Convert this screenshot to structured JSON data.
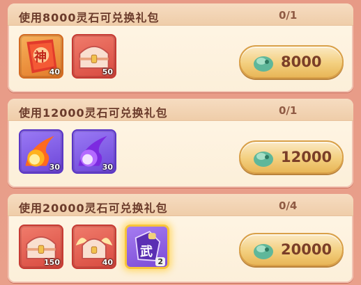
{
  "packs": [
    {
      "title": "使用8000灵石可兑换礼包",
      "count": "0/1",
      "price": "8000",
      "items": [
        {
          "icon": "scroll-icon",
          "qty": "40",
          "color": "orange"
        },
        {
          "icon": "treasure-chest-icon",
          "qty": "50",
          "color": "red"
        }
      ]
    },
    {
      "title": "使用12000灵石可兑换礼包",
      "count": "0/1",
      "price": "12000",
      "items": [
        {
          "icon": "orange-fireball-icon",
          "qty": "30",
          "color": "purple"
        },
        {
          "icon": "purple-fireball-icon",
          "qty": "30",
          "color": "purple"
        }
      ]
    },
    {
      "title": "使用20000灵石可兑换礼包",
      "count": "0/4",
      "price": "20000",
      "items": [
        {
          "icon": "treasure-chest-icon",
          "qty": "150",
          "color": "red"
        },
        {
          "icon": "winged-chest-icon",
          "qty": "40",
          "color": "red"
        },
        {
          "icon": "martial-token-icon",
          "qty": "2",
          "color": "gold"
        }
      ]
    }
  ],
  "scroll_glyph": "神",
  "token_glyph": "武"
}
